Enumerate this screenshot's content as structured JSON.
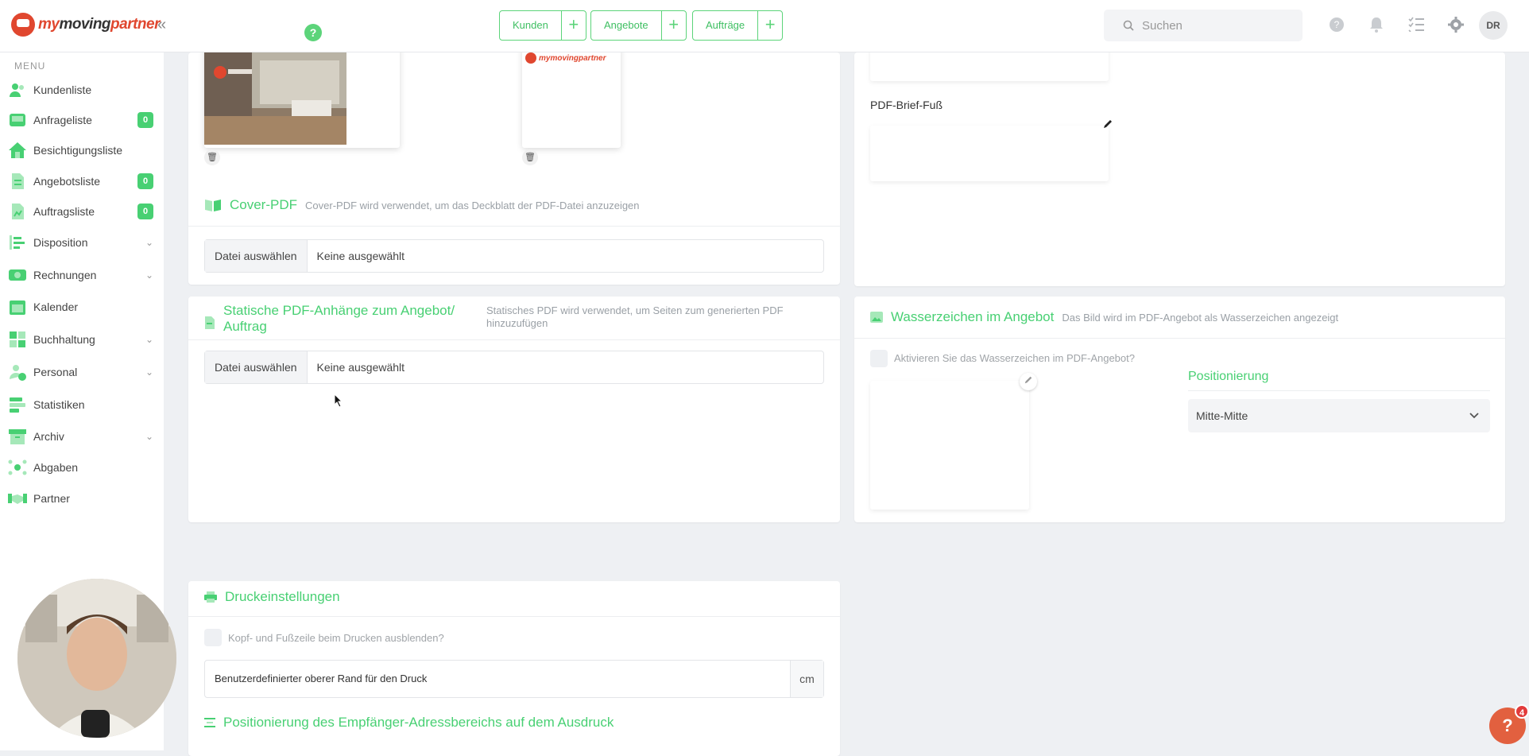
{
  "app": {
    "logo_text_a": "my",
    "logo_text_b": "moving",
    "logo_text_c": "partner",
    "collapse_icon": "«"
  },
  "header": {
    "quick_actions": [
      {
        "label": "Kunden",
        "plus": "+"
      },
      {
        "label": "Angebote",
        "plus": "+"
      },
      {
        "label": "Aufträge",
        "plus": "+"
      }
    ],
    "search_placeholder": "Suchen",
    "help_dot": "?",
    "user_initials": "DR"
  },
  "sidebar": {
    "menu_heading": "MENU",
    "items": [
      {
        "label": "Kundenliste",
        "icon": "users-icon"
      },
      {
        "label": "Anfrageliste",
        "icon": "inbox-icon",
        "badge": "0"
      },
      {
        "label": "Besichtigungsliste",
        "icon": "home-icon"
      },
      {
        "label": "Angebotsliste",
        "icon": "document-icon",
        "badge": "0"
      },
      {
        "label": "Auftragsliste",
        "icon": "file-icon",
        "badge": "0"
      },
      {
        "label": "Disposition",
        "icon": "tasks-icon",
        "chevron": "⌄"
      },
      {
        "label": "Rechnungen",
        "icon": "money-icon",
        "chevron": "⌄"
      },
      {
        "label": "Kalender",
        "icon": "calendar-icon"
      },
      {
        "label": "Buchhaltung",
        "icon": "grid-icon",
        "chevron": "⌄"
      },
      {
        "label": "Personal",
        "icon": "person-clock-icon",
        "chevron": "⌄"
      },
      {
        "label": "Statistiken",
        "icon": "stats-icon"
      },
      {
        "label": "Archiv",
        "icon": "archive-icon",
        "chevron": "⌄"
      },
      {
        "label": "Abgaben",
        "icon": "network-icon"
      },
      {
        "label": "Partner",
        "icon": "handshake-icon"
      }
    ]
  },
  "cover_pdf": {
    "title": "Cover-PDF",
    "description": "Cover-PDF wird verwendet, um das Deckblatt der PDF-Datei anzuzeigen",
    "file_button": "Datei auswählen",
    "file_value": "Keine ausgewählt",
    "thumb_logo_text": "mymovingpartner"
  },
  "static_pdf": {
    "title": "Statische PDF-Anhänge zum Angebot/ Auftrag",
    "description": "Statisches PDF wird verwendet, um Seiten zum generierten PDF hinzuzufügen",
    "file_button": "Datei auswählen",
    "file_value": "Keine ausgewählt"
  },
  "pdf_footer": {
    "label": "PDF-Brief-Fuß"
  },
  "watermark": {
    "title": "Wasserzeichen im Angebot",
    "description": "Das Bild wird im PDF-Angebot als Wasserzeichen angezeigt",
    "checkbox_label": "Aktivieren Sie das Wasserzeichen im PDF-Angebot?",
    "positioning_label": "Positionierung",
    "positioning_value": "Mitte-Mitte"
  },
  "print": {
    "title": "Druckeinstellungen",
    "checkbox_label": "Kopf- und Fußzeile beim Drucken ausblenden?",
    "margin_label": "Benutzerdefinierter oberer Rand für den Druck",
    "margin_unit": "cm",
    "next_section_title": "Positionierung des Empfänger-Adressbereichs auf dem Ausdruck"
  },
  "help_fab": {
    "icon": "?",
    "count": "4"
  },
  "colors": {
    "accent": "#48d073",
    "brand": "#e0472f"
  }
}
